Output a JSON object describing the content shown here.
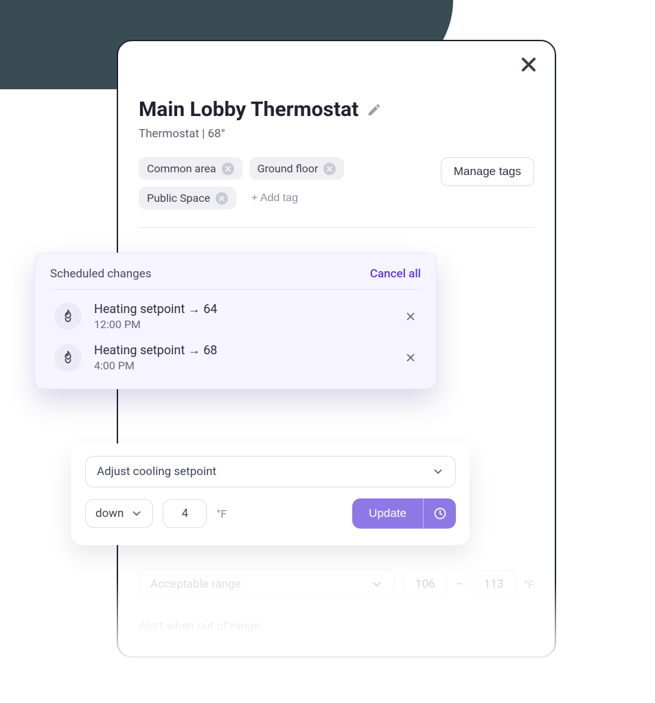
{
  "header": {
    "title": "Main Lobby Thermostat",
    "subtitle": "Thermostat | 68°"
  },
  "tags": {
    "items": [
      "Common area",
      "Ground floor",
      "Public Space"
    ],
    "add_label": "+ Add tag",
    "manage_label": "Manage tags"
  },
  "scheduled": {
    "heading": "Scheduled changes",
    "cancel_all": "Cancel all",
    "items": [
      {
        "line": "Heating setpoint → 64",
        "time": "12:00 PM"
      },
      {
        "line": "Heating setpoint → 68",
        "time": "4:00 PM"
      }
    ]
  },
  "adjust": {
    "action": "Adjust cooling setpoint",
    "direction": "down",
    "amount": "4",
    "unit": "°F",
    "update": "Update"
  },
  "range": {
    "label": "Acceptable range",
    "low": "106",
    "high": "113",
    "unit": "°F",
    "alert_label": "Alert when out of range"
  }
}
